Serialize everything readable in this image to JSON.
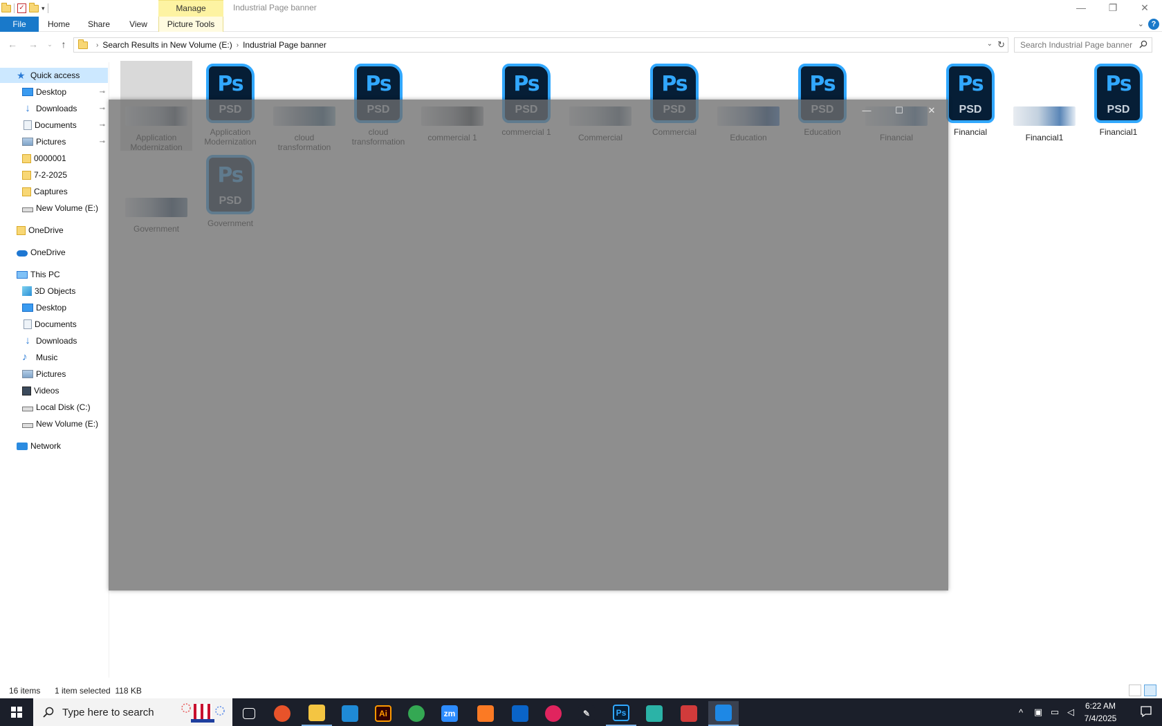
{
  "titlebar": {
    "manage_tab": "Manage",
    "title": "Industrial Page banner",
    "minimize": "—",
    "restore": "❐",
    "close": "✕"
  },
  "ribbon": {
    "tabs": [
      "File",
      "Home",
      "Share",
      "View",
      "Picture Tools"
    ]
  },
  "address": {
    "crumbs": [
      "Search Results in New Volume (E:)",
      "Industrial Page banner"
    ],
    "search_placeholder": "Search Industrial Page banner"
  },
  "sidebar": {
    "items": [
      {
        "label": "Quick access",
        "icon": "star-icon",
        "pinned": false
      },
      {
        "label": "Desktop",
        "icon": "desktop-icon",
        "pinned": true
      },
      {
        "label": "Downloads",
        "icon": "download-icon",
        "pinned": true
      },
      {
        "label": "Documents",
        "icon": "document-icon",
        "pinned": true
      },
      {
        "label": "Pictures",
        "icon": "pictures-icon",
        "pinned": true
      },
      {
        "label": "0000001",
        "icon": "folder-icon",
        "pinned": false
      },
      {
        "label": "7-2-2025",
        "icon": "folder-icon",
        "pinned": false
      },
      {
        "label": "Captures",
        "icon": "folder-icon",
        "pinned": false
      },
      {
        "label": "New Volume (E:)",
        "icon": "drive-icon",
        "pinned": false
      },
      {
        "label": "OneDrive",
        "icon": "folder-icon",
        "pinned": false
      },
      {
        "label": "OneDrive",
        "icon": "cloud-icon",
        "pinned": false
      },
      {
        "label": "This PC",
        "icon": "computer-icon",
        "pinned": false
      },
      {
        "label": "3D Objects",
        "icon": "cube-icon",
        "pinned": false
      },
      {
        "label": "Desktop",
        "icon": "desktop-icon",
        "pinned": false
      },
      {
        "label": "Documents",
        "icon": "document-icon",
        "pinned": false
      },
      {
        "label": "Downloads",
        "icon": "download-icon",
        "pinned": false
      },
      {
        "label": "Music",
        "icon": "music-icon",
        "pinned": false
      },
      {
        "label": "Pictures",
        "icon": "pictures-icon",
        "pinned": false
      },
      {
        "label": "Videos",
        "icon": "video-icon",
        "pinned": false
      },
      {
        "label": "Local Disk (C:)",
        "icon": "drive-icon",
        "pinned": false
      },
      {
        "label": "New Volume (E:)",
        "icon": "drive-icon",
        "pinned": false
      },
      {
        "label": "Network",
        "icon": "network-icon",
        "pinned": false
      }
    ]
  },
  "files": [
    {
      "label": "Application Modernization",
      "kind": "image",
      "selected": true
    },
    {
      "label": "Application Modernization",
      "kind": "psd"
    },
    {
      "label": "cloud transformation",
      "kind": "image"
    },
    {
      "label": "cloud transformation",
      "kind": "psd"
    },
    {
      "label": "commercial 1",
      "kind": "image"
    },
    {
      "label": "commercial 1",
      "kind": "psd"
    },
    {
      "label": "Commercial",
      "kind": "image"
    },
    {
      "label": "Commercial",
      "kind": "psd"
    },
    {
      "label": "Education",
      "kind": "image"
    },
    {
      "label": "Education",
      "kind": "psd"
    },
    {
      "label": "Financial",
      "kind": "image"
    },
    {
      "label": "Financial",
      "kind": "psd"
    },
    {
      "label": "Financial1",
      "kind": "image"
    },
    {
      "label": "Financial1",
      "kind": "psd"
    },
    {
      "label": "Government",
      "kind": "image"
    },
    {
      "label": "Government",
      "kind": "psd"
    }
  ],
  "psd_icon": {
    "letters": "Ps",
    "ext": "PSD"
  },
  "overlay": {
    "minimize": "—",
    "maximize": "☐",
    "close": "✕"
  },
  "status": {
    "item_count": "16 items",
    "selection": "1 item selected  118 KB"
  },
  "taskbar": {
    "search_placeholder": "Type here to search",
    "apps": [
      {
        "name": "task-view",
        "label": "",
        "color": "#1b1f2a",
        "running": false
      },
      {
        "name": "firefox",
        "label": "",
        "color": "#e8532a",
        "running": false
      },
      {
        "name": "file-explorer",
        "label": "",
        "color": "#f4c542",
        "running": true
      },
      {
        "name": "vscode",
        "label": "",
        "color": "#1f8ad6",
        "running": false
      },
      {
        "name": "illustrator",
        "label": "Ai",
        "color": "#330000",
        "running": false
      },
      {
        "name": "chrome",
        "label": "",
        "color": "#34a853",
        "running": false
      },
      {
        "name": "zoom",
        "label": "zm",
        "color": "#2d8cff",
        "running": false
      },
      {
        "name": "xampp",
        "label": "",
        "color": "#fb7a24",
        "running": false
      },
      {
        "name": "outlook",
        "label": "",
        "color": "#0a64c8",
        "running": false
      },
      {
        "name": "creative-cloud",
        "label": "",
        "color": "#e0245e",
        "running": false
      },
      {
        "name": "pen-tool",
        "label": "",
        "color": "#1b1f2a",
        "running": false
      },
      {
        "name": "photoshop",
        "label": "Ps",
        "color": "#061e36",
        "running": true
      },
      {
        "name": "sketchup",
        "label": "",
        "color": "#2bb3a7",
        "running": false
      },
      {
        "name": "snipping",
        "label": "",
        "color": "#d13b3b",
        "running": false
      },
      {
        "name": "photos",
        "label": "",
        "color": "#1e88e5",
        "running": true,
        "active": true
      }
    ],
    "clock_time": "6:22 AM",
    "clock_date": "7/4/2025"
  }
}
